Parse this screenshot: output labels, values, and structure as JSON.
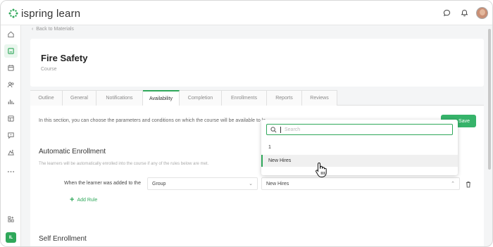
{
  "header": {
    "logo_prefix": "ispring",
    "logo_suffix": "learn",
    "icons": [
      "chat-icon",
      "bell-icon",
      "avatar"
    ]
  },
  "sidebar": {
    "items": [
      "home-icon",
      "materials-icon",
      "calendar-icon",
      "users-icon",
      "reports-icon",
      "schedule-icon",
      "feedback-icon",
      "gamification-icon",
      "more-icon"
    ],
    "bottom": [
      "integrations-icon"
    ],
    "user_initials": "IL"
  },
  "breadcrumb": {
    "back_label": "Back to Materials"
  },
  "course": {
    "title": "Fire Safety",
    "type": "Course"
  },
  "tabs": [
    "Outline",
    "General",
    "Notifications",
    "Availability",
    "Completion",
    "Enrollments",
    "Reports",
    "Reviews"
  ],
  "active_tab": "Availability",
  "availability": {
    "intro": "In this section, you can choose the parameters and conditions on which the course will be available to le",
    "save_label": "Save",
    "auto_title": "Automatic Enrollment",
    "auto_desc": "The learners will be automatically enrolled into the course if any of the rules below are met.",
    "rule_label": "When the learner was added to the",
    "rule_type": "Group",
    "rule_value": "New Hires",
    "add_rule": "Add Rule",
    "self_title": "Self Enrollment"
  },
  "dropdown": {
    "search_placeholder": "Search",
    "items": [
      "1",
      "New Hires"
    ]
  },
  "colors": {
    "accent": "#2fa85a",
    "save": "#36b36a"
  }
}
